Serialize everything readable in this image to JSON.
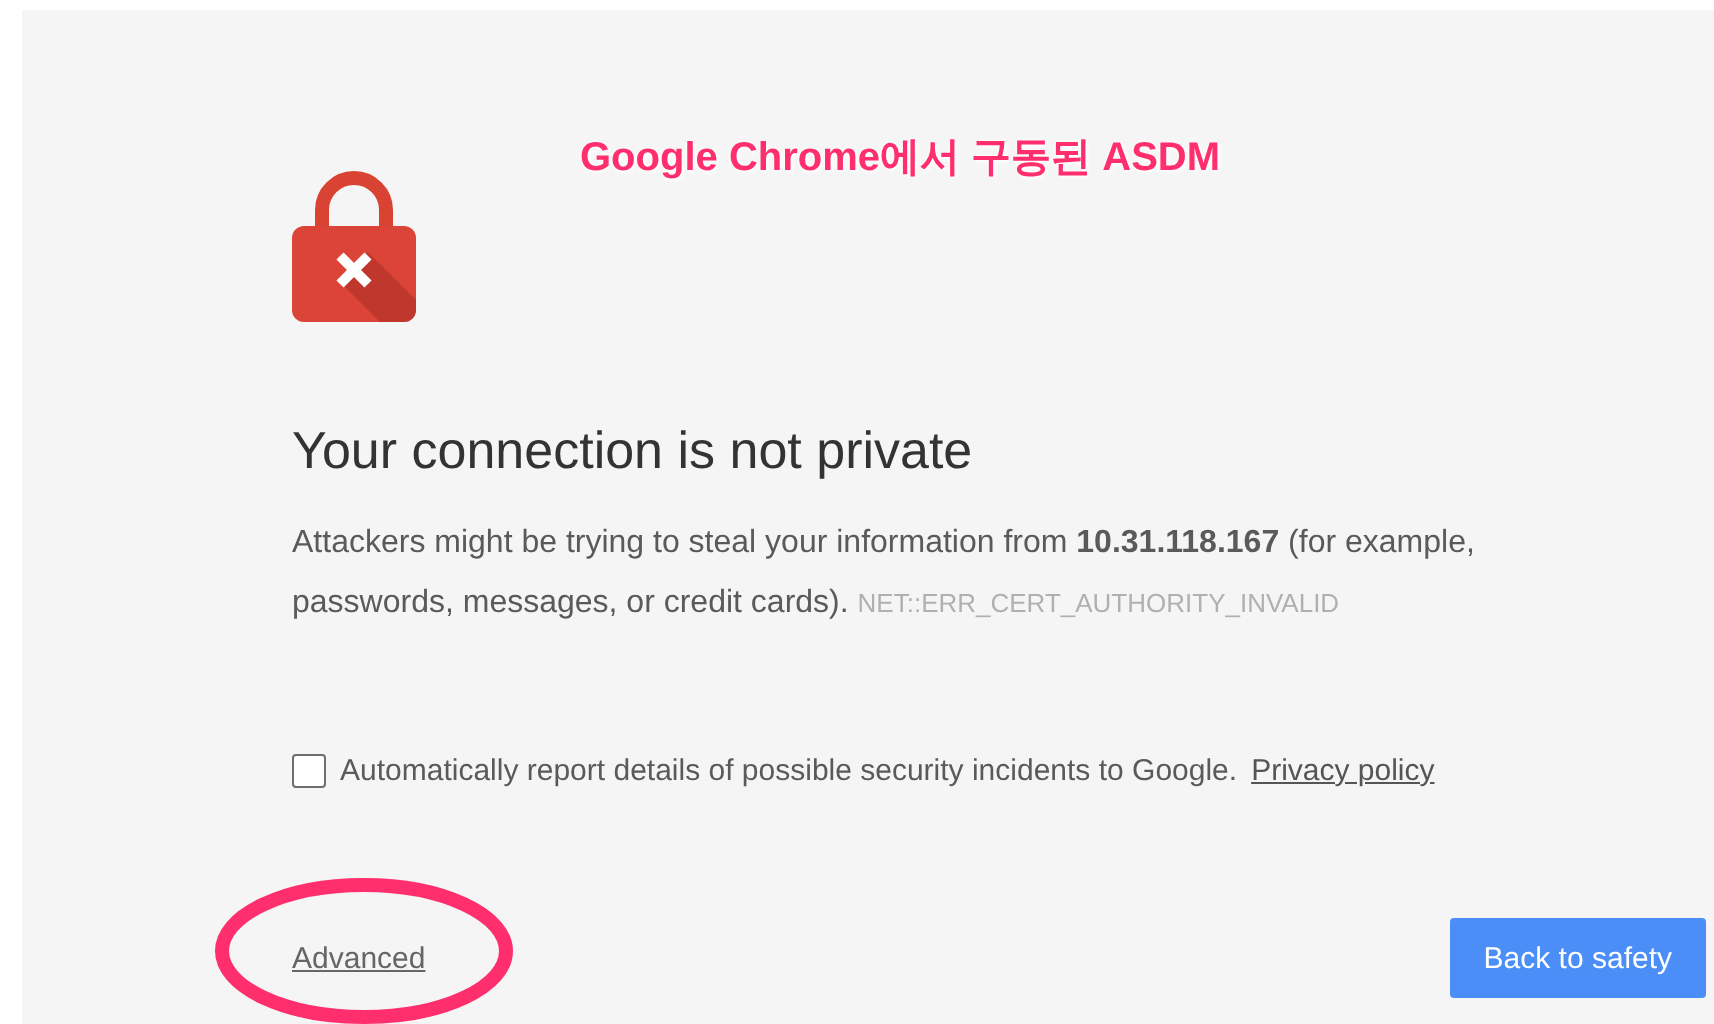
{
  "annotation": {
    "caption": "Google Chrome에서 구동된 ASDM",
    "highlights_advanced": true
  },
  "heading": "Your connection is not private",
  "message": "Attackers might be trying to steal your information from **10.31.118.167** (for example, passwords, messages, or credit cards).",
  "error_code": "NET::ERR_CERT_AUTHORITY_INVALID",
  "report_checkbox": {
    "label": "Automatically report details of possible security incidents to Google.",
    "checked": false,
    "link": "Privacy policy"
  },
  "advanced_link": "Advanced",
  "primary_button": "Back to safety"
}
